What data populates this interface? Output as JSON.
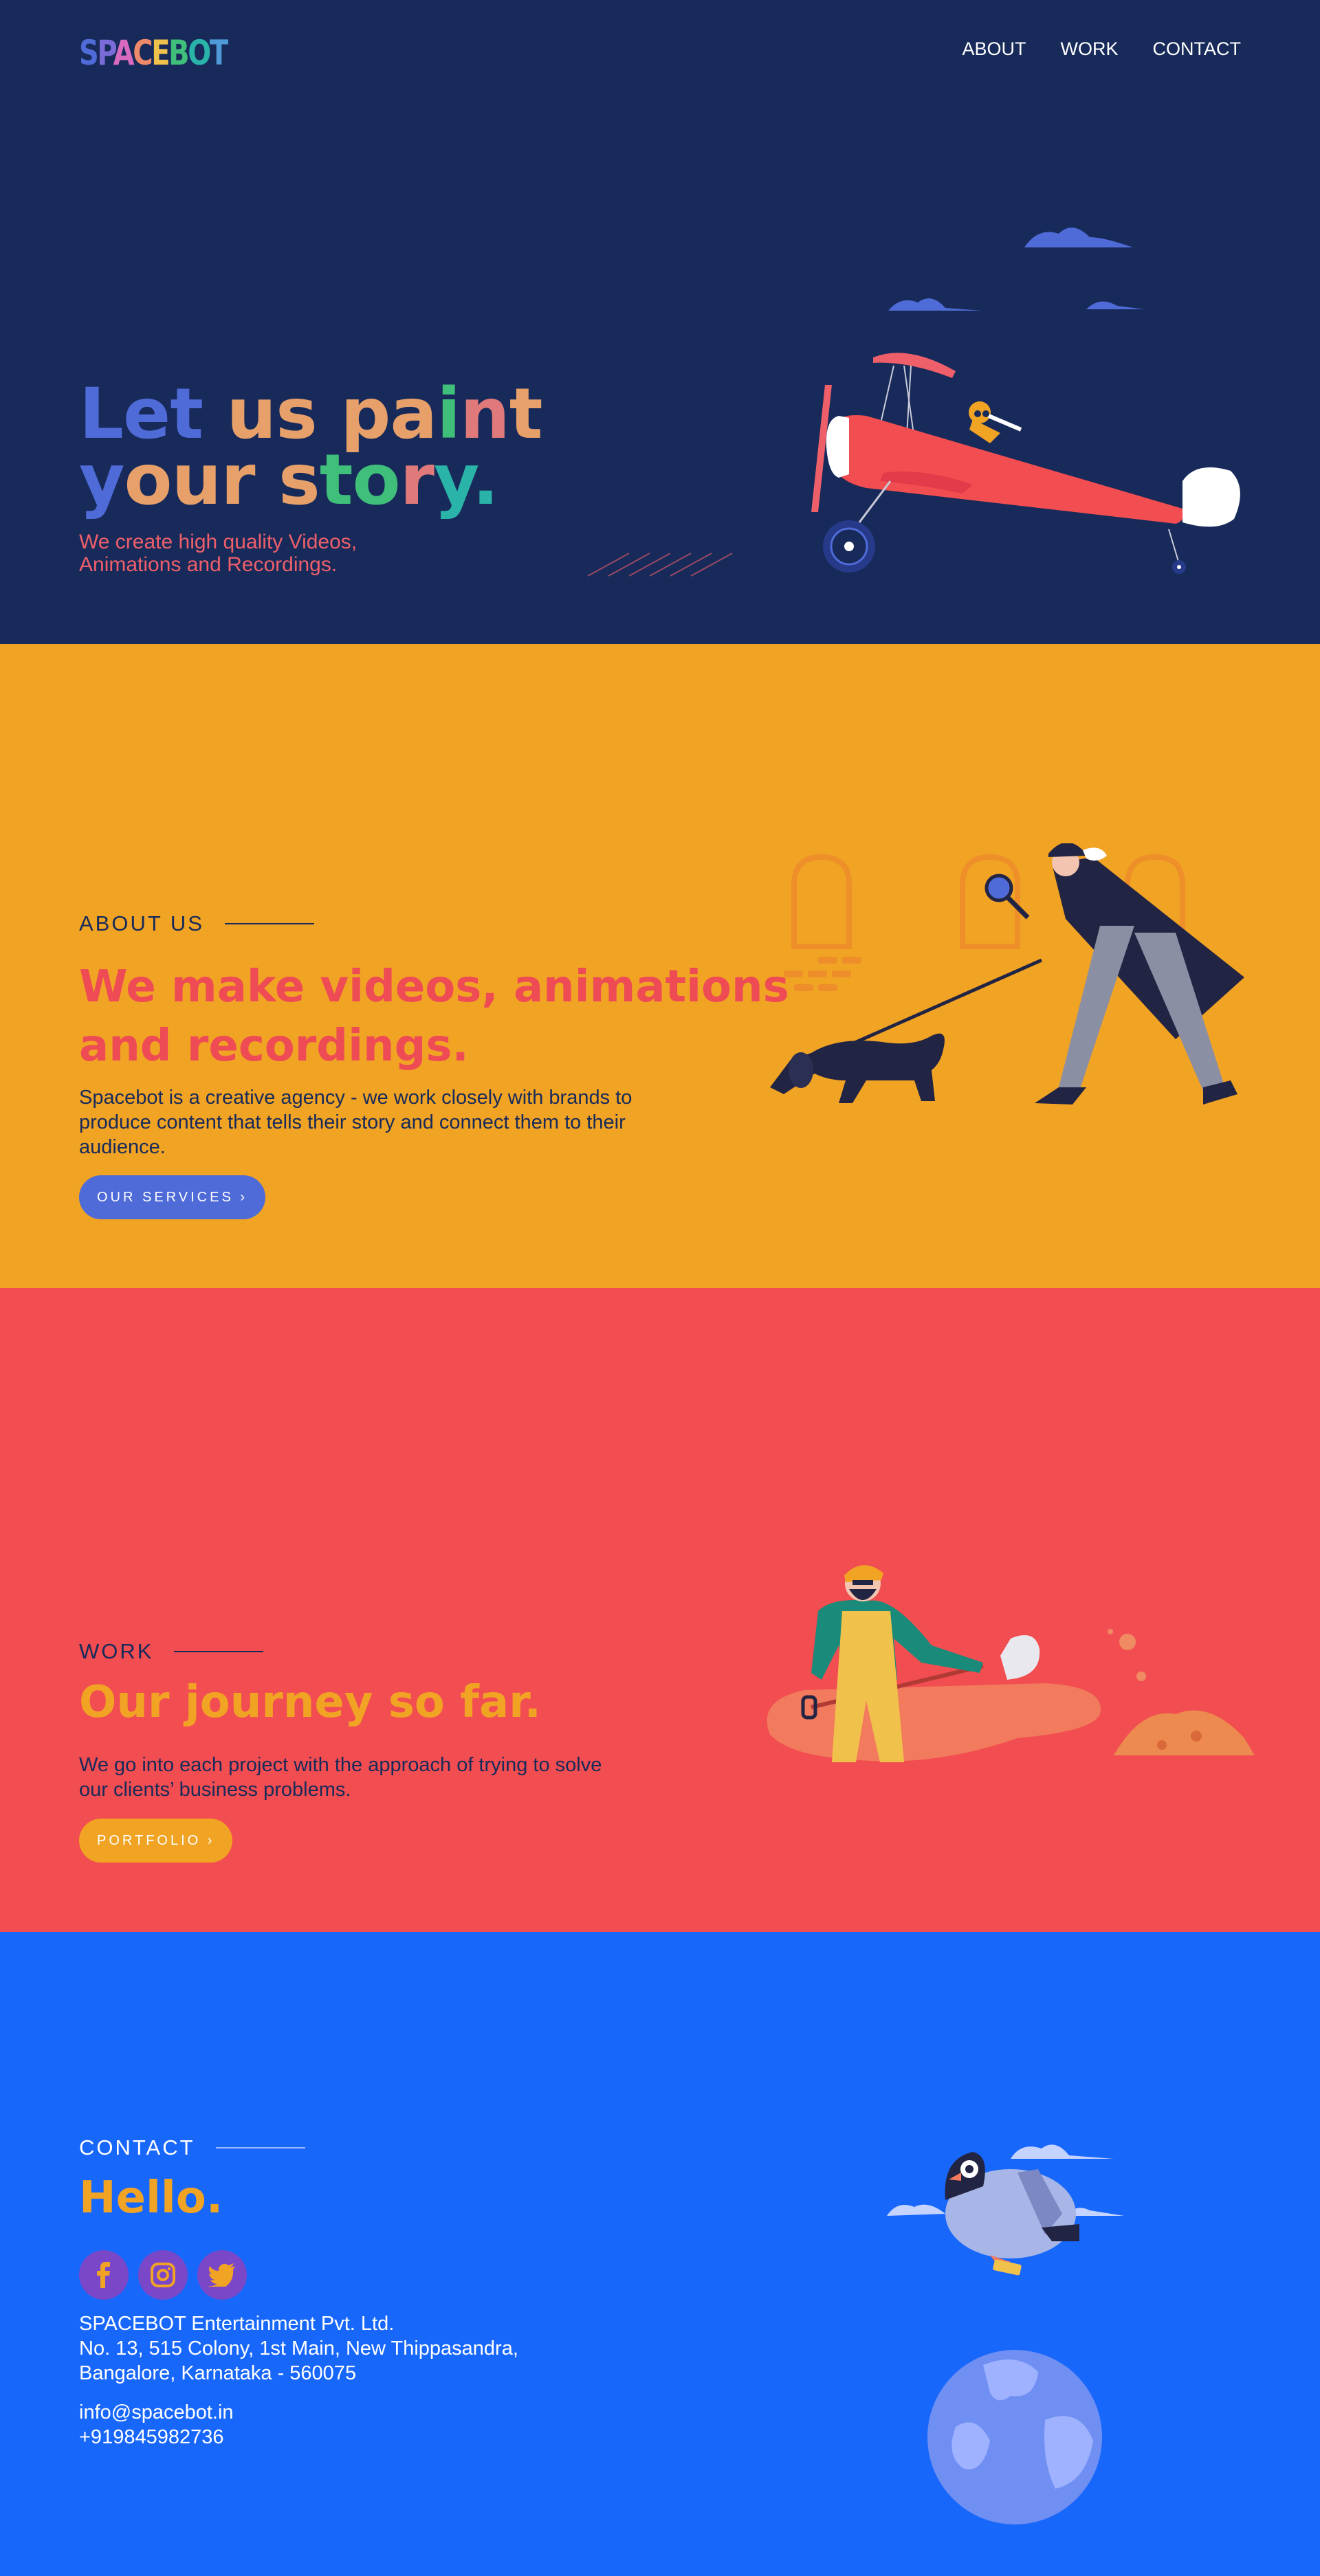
{
  "header": {
    "logo": "SPACEBOT",
    "nav": [
      "ABOUT",
      "WORK",
      "CONTACT"
    ]
  },
  "hero": {
    "title_line1": "Let us paint",
    "title_line2": "your story.",
    "subtitle": "We create high quality Videos, Animations and Recordings."
  },
  "about": {
    "label": "ABOUT US",
    "heading_line1": "We make videos, animations",
    "heading_line2": "and recordings.",
    "body": "Spacebot is a creative agency - we work closely with brands to produce content that tells their story and connect them to their audience.",
    "button": "OUR SERVICES ›"
  },
  "work": {
    "label": "WORK",
    "heading": "Our journey so far.",
    "body": "We go into each project with the approach of trying to solve our clients’ business problems.",
    "button": "PORTFOLIO ›"
  },
  "contact": {
    "label": "CONTACT",
    "heading": "Hello.",
    "socials": [
      "facebook-icon",
      "instagram-icon",
      "twitter-icon"
    ],
    "company": "SPACEBOT Entertainment Pvt. Ltd.",
    "address_line1": "No. 13, 515 Colony, 1st Main, New Thippasandra,",
    "address_line2": "Bangalore, Karnataka - 560075",
    "email": "info@spacebot.in",
    "phone": "+919845982736"
  },
  "colors": {
    "hero_bg": "#172a5a",
    "about_bg": "#f1a324",
    "work_bg": "#f24d50",
    "contact_bg": "#1867fb",
    "button_blue": "#4f6bd8",
    "button_orange": "#f1a324",
    "accent_red": "#ee5f6a"
  }
}
